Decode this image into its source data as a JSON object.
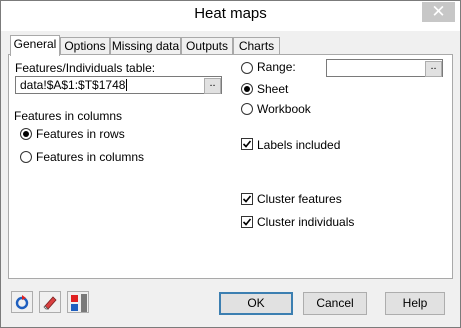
{
  "window": {
    "title": "Heat maps",
    "close_glyph": "✕"
  },
  "tabs": [
    {
      "label": "General",
      "active": true
    },
    {
      "label": "Options",
      "active": false
    },
    {
      "label": "Missing data",
      "active": false
    },
    {
      "label": "Outputs",
      "active": false
    },
    {
      "label": "Charts",
      "active": false
    }
  ],
  "general": {
    "table_label": "Features/Individuals table:",
    "table_value": "data!$A$1:$T$1748",
    "browse_glyph": "..",
    "orientation_label": "Features in columns",
    "orientation_options": [
      {
        "label": "Features in rows",
        "selected": true
      },
      {
        "label": "Features in columns",
        "selected": false
      }
    ],
    "output_options": [
      {
        "label": "Range:",
        "selected": false
      },
      {
        "label": "Sheet",
        "selected": true
      },
      {
        "label": "Workbook",
        "selected": false
      }
    ],
    "range_value": "",
    "labels_included": {
      "label": "Labels included",
      "checked": true
    },
    "cluster_features": {
      "label": "Cluster features",
      "checked": true
    },
    "cluster_individuals": {
      "label": "Cluster individuals",
      "checked": true
    }
  },
  "footer": {
    "ok": "OK",
    "cancel": "Cancel",
    "help": "Help",
    "tool_icons": [
      "reset-icon",
      "eraser-icon",
      "toggle-view-icon"
    ]
  },
  "colors": {
    "dialog_bg": "#f0f0f0",
    "panel_bg": "#ffffff",
    "default_button_border": "#3c7fb1",
    "icon_blue": "#1f5fbf",
    "icon_red": "#e02020"
  }
}
